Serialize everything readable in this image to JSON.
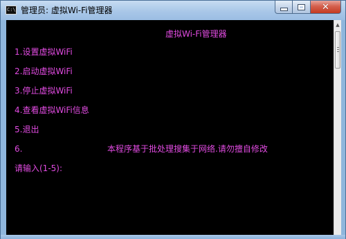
{
  "window": {
    "title": "管理员: 虚拟Wi-Fi管理器",
    "icon": "console-icon",
    "icon_text": "C:\\"
  },
  "console": {
    "header": "虚拟Wi-Fi管理器",
    "menu": [
      "1.设置虚拟WiFi",
      "2.启动虚拟WiFi",
      "3.停止虚拟WiFi",
      "4.查看虚拟WiFi信息",
      "5.退出"
    ],
    "option6_prefix": "6.",
    "notice": "本程序基于批处理搜集于网络.请勿擅自修改",
    "prompt": "请输入(1-5):",
    "text_color": "#e14be1",
    "background": "#000000"
  },
  "colors": {
    "titlebar": "#a9c7e8",
    "close_button": "#c43a22"
  }
}
